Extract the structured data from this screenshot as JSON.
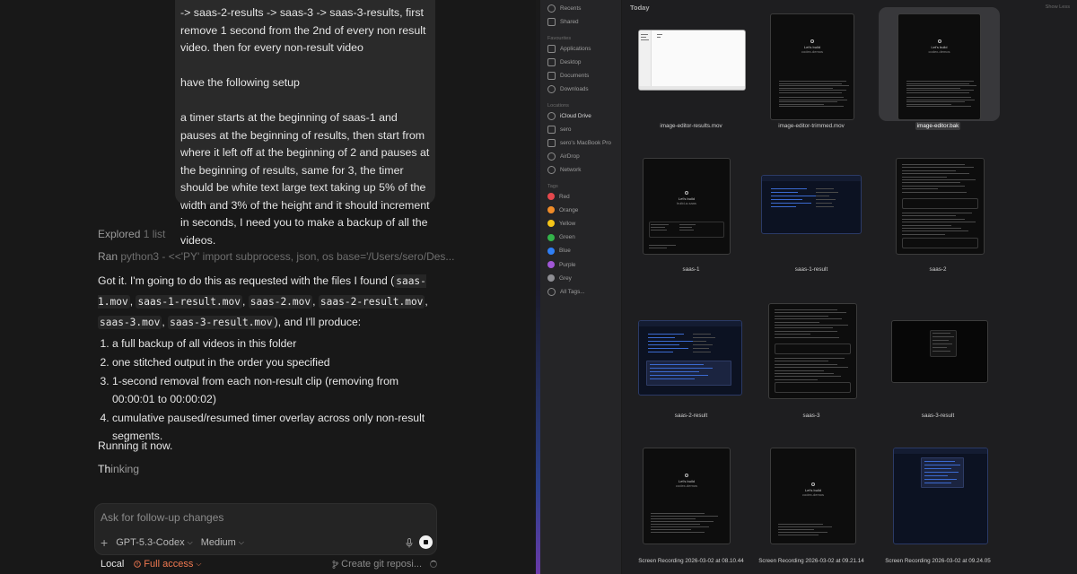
{
  "chat": {
    "user_message": [
      "-> saas-2-results -> saas-3 -> saas-3-results, first remove 1 second from the 2nd of every non result video. then for every non-result video",
      "have the following setup",
      "a timer starts at the beginning of saas-1 and pauses at the beginning of results, then start from where it left off at the beginning of 2 and pauses at the beginning of results, same for 3, the timer should be white text large text taking up 5% of the width and 3% of the height and it should increment in seconds, I need you to make a backup of all the videos."
    ],
    "explored": {
      "verb": "Explored",
      "detail": "1 list"
    },
    "ran": {
      "verb": "Ran",
      "detail": "python3 - <<'PY' import subprocess, json, os base='/Users/sero/Des..."
    },
    "reply": {
      "intro_before": "Got it. I'm going to do this as requested with the files I found (",
      "files": [
        "saas-1.mov",
        "saas-1-result.mov",
        "saas-2.mov",
        "saas-2-result.mov",
        "saas-3.mov",
        "saas-3-result.mov"
      ],
      "intro_after": "), and I'll produce:",
      "steps": [
        "a full backup of all videos in this folder",
        "one stitched output in the order you specified",
        "1-second removal from each non-result clip (removing from 00:00:01 to 00:00:02)",
        "cumulative paused/resumed timer overlay across only non-result segments."
      ]
    },
    "running": "Running it now.",
    "thinking_hi": "Th",
    "thinking_rest": "inking",
    "composer": {
      "placeholder": "Ask for follow-up changes",
      "model": "GPT-5.3-Codex",
      "effort": "Medium"
    },
    "footer": {
      "location": "Local",
      "access": "Full access",
      "git": "Create git reposi..."
    }
  },
  "finder": {
    "sidebar": {
      "top": [
        "Recents",
        "Shared"
      ],
      "favourites_title": "Favourites",
      "favourites": [
        "Applications",
        "Desktop",
        "Documents",
        "Downloads"
      ],
      "locations_title": "Locations",
      "locations": [
        "iCloud Drive",
        "sero",
        "sero's MacBook Pro",
        "AirDrop",
        "Network"
      ],
      "tags_title": "Tags",
      "tags": [
        {
          "name": "Red",
          "color": "#e5484d"
        },
        {
          "name": "Orange",
          "color": "#f08c28"
        },
        {
          "name": "Yellow",
          "color": "#f5c518"
        },
        {
          "name": "Green",
          "color": "#33b34a"
        },
        {
          "name": "Blue",
          "color": "#2f7ff5"
        },
        {
          "name": "Purple",
          "color": "#a157d6"
        },
        {
          "name": "Grey",
          "color": "#8e8e93"
        }
      ],
      "all_tags": "All Tags..."
    },
    "section_title": "Today",
    "show_less": "Show Less",
    "files": [
      "image-editor-results.mov",
      "image-editor-trimmed.mov",
      "image-editor.bak",
      "saas-1",
      "saas-1-result",
      "saas-2",
      "saas-2-result",
      "saas-3",
      "saas-3-result",
      "Screen Recording 2026-03-02 at 08.10.44",
      "Screen Recording 2026-03-02 at 09.21.14",
      "Screen Recording 2026-03-02 at 09.24.05"
    ],
    "selected_file": "image-editor.bak",
    "thumb_text": {
      "lets_build": "Let's build",
      "codex_demos": "codex-demos",
      "build_saas": "build-a-saas"
    }
  },
  "colors": {
    "accent_warning": "#f07850",
    "chat_bg": "#181818",
    "finder_bg": "#1e1e20"
  }
}
